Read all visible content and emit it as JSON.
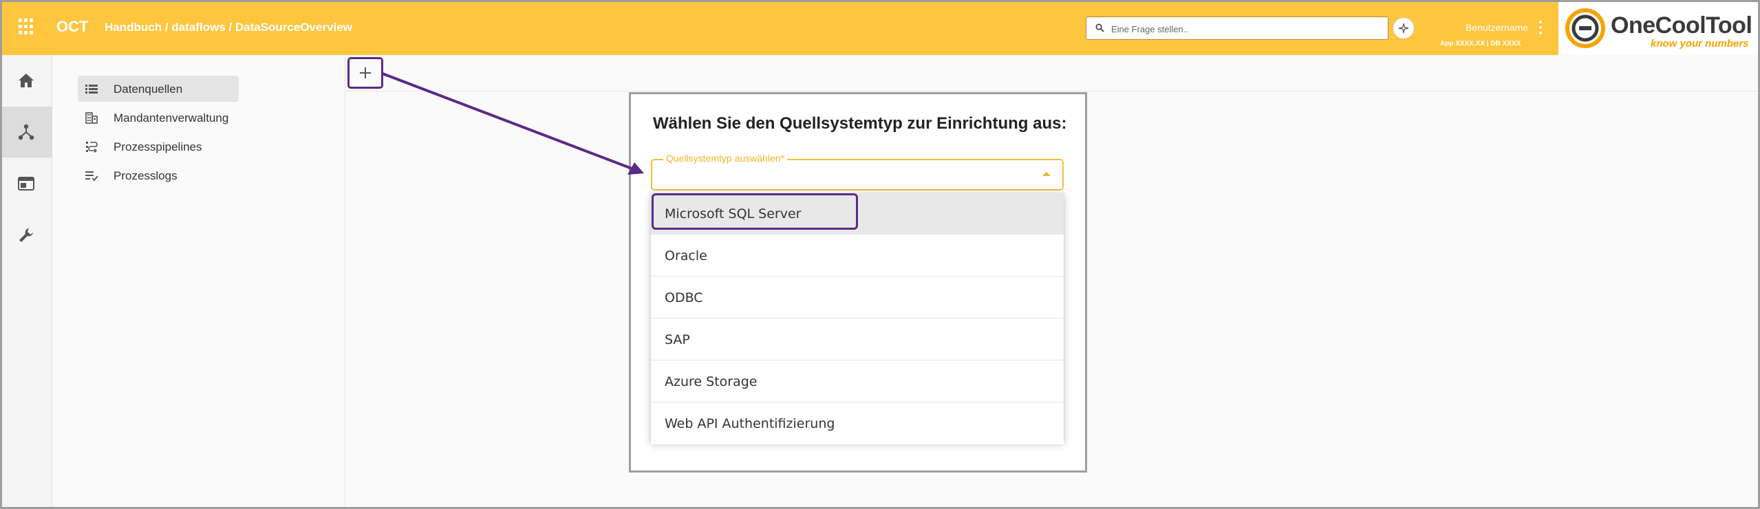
{
  "header": {
    "app_title": "OCT",
    "breadcrumb": "Handbuch / dataflows / DataSourceOverview",
    "search_placeholder": "Eine Frage stellen..",
    "username": "Benutzername",
    "app_info": "App XXXX.XX | DB XXXX",
    "logo_name": "OneCoolTool",
    "logo_tagline": "know your numbers",
    "accent_color": "#fec63f"
  },
  "rail": {
    "items": [
      {
        "icon": "home-icon"
      },
      {
        "icon": "dataflow-icon",
        "active": true
      },
      {
        "icon": "browser-window-icon"
      },
      {
        "icon": "wrench-icon"
      }
    ]
  },
  "sidenav": {
    "items": [
      {
        "label": "Datenquellen",
        "icon": "list-icon",
        "active": true
      },
      {
        "label": "Mandantenverwaltung",
        "icon": "building-icon"
      },
      {
        "label": "Prozesspipelines",
        "icon": "pipeline-icon"
      },
      {
        "label": "Prozesslogs",
        "icon": "log-list-icon"
      }
    ]
  },
  "main": {
    "add_button_icon": "plus-icon"
  },
  "dialog": {
    "title": "Wählen Sie den Quellsystemtyp zur Einrichtung aus:",
    "select_label": "Quellsystemtyp auswählen*",
    "options": [
      {
        "label": "Microsoft SQL Server",
        "highlighted": true
      },
      {
        "label": "Oracle"
      },
      {
        "label": "ODBC"
      },
      {
        "label": "SAP"
      },
      {
        "label": "Azure Storage"
      },
      {
        "label": "Web API Authentifizierung"
      }
    ]
  },
  "annotation_color": "#5b2a86"
}
